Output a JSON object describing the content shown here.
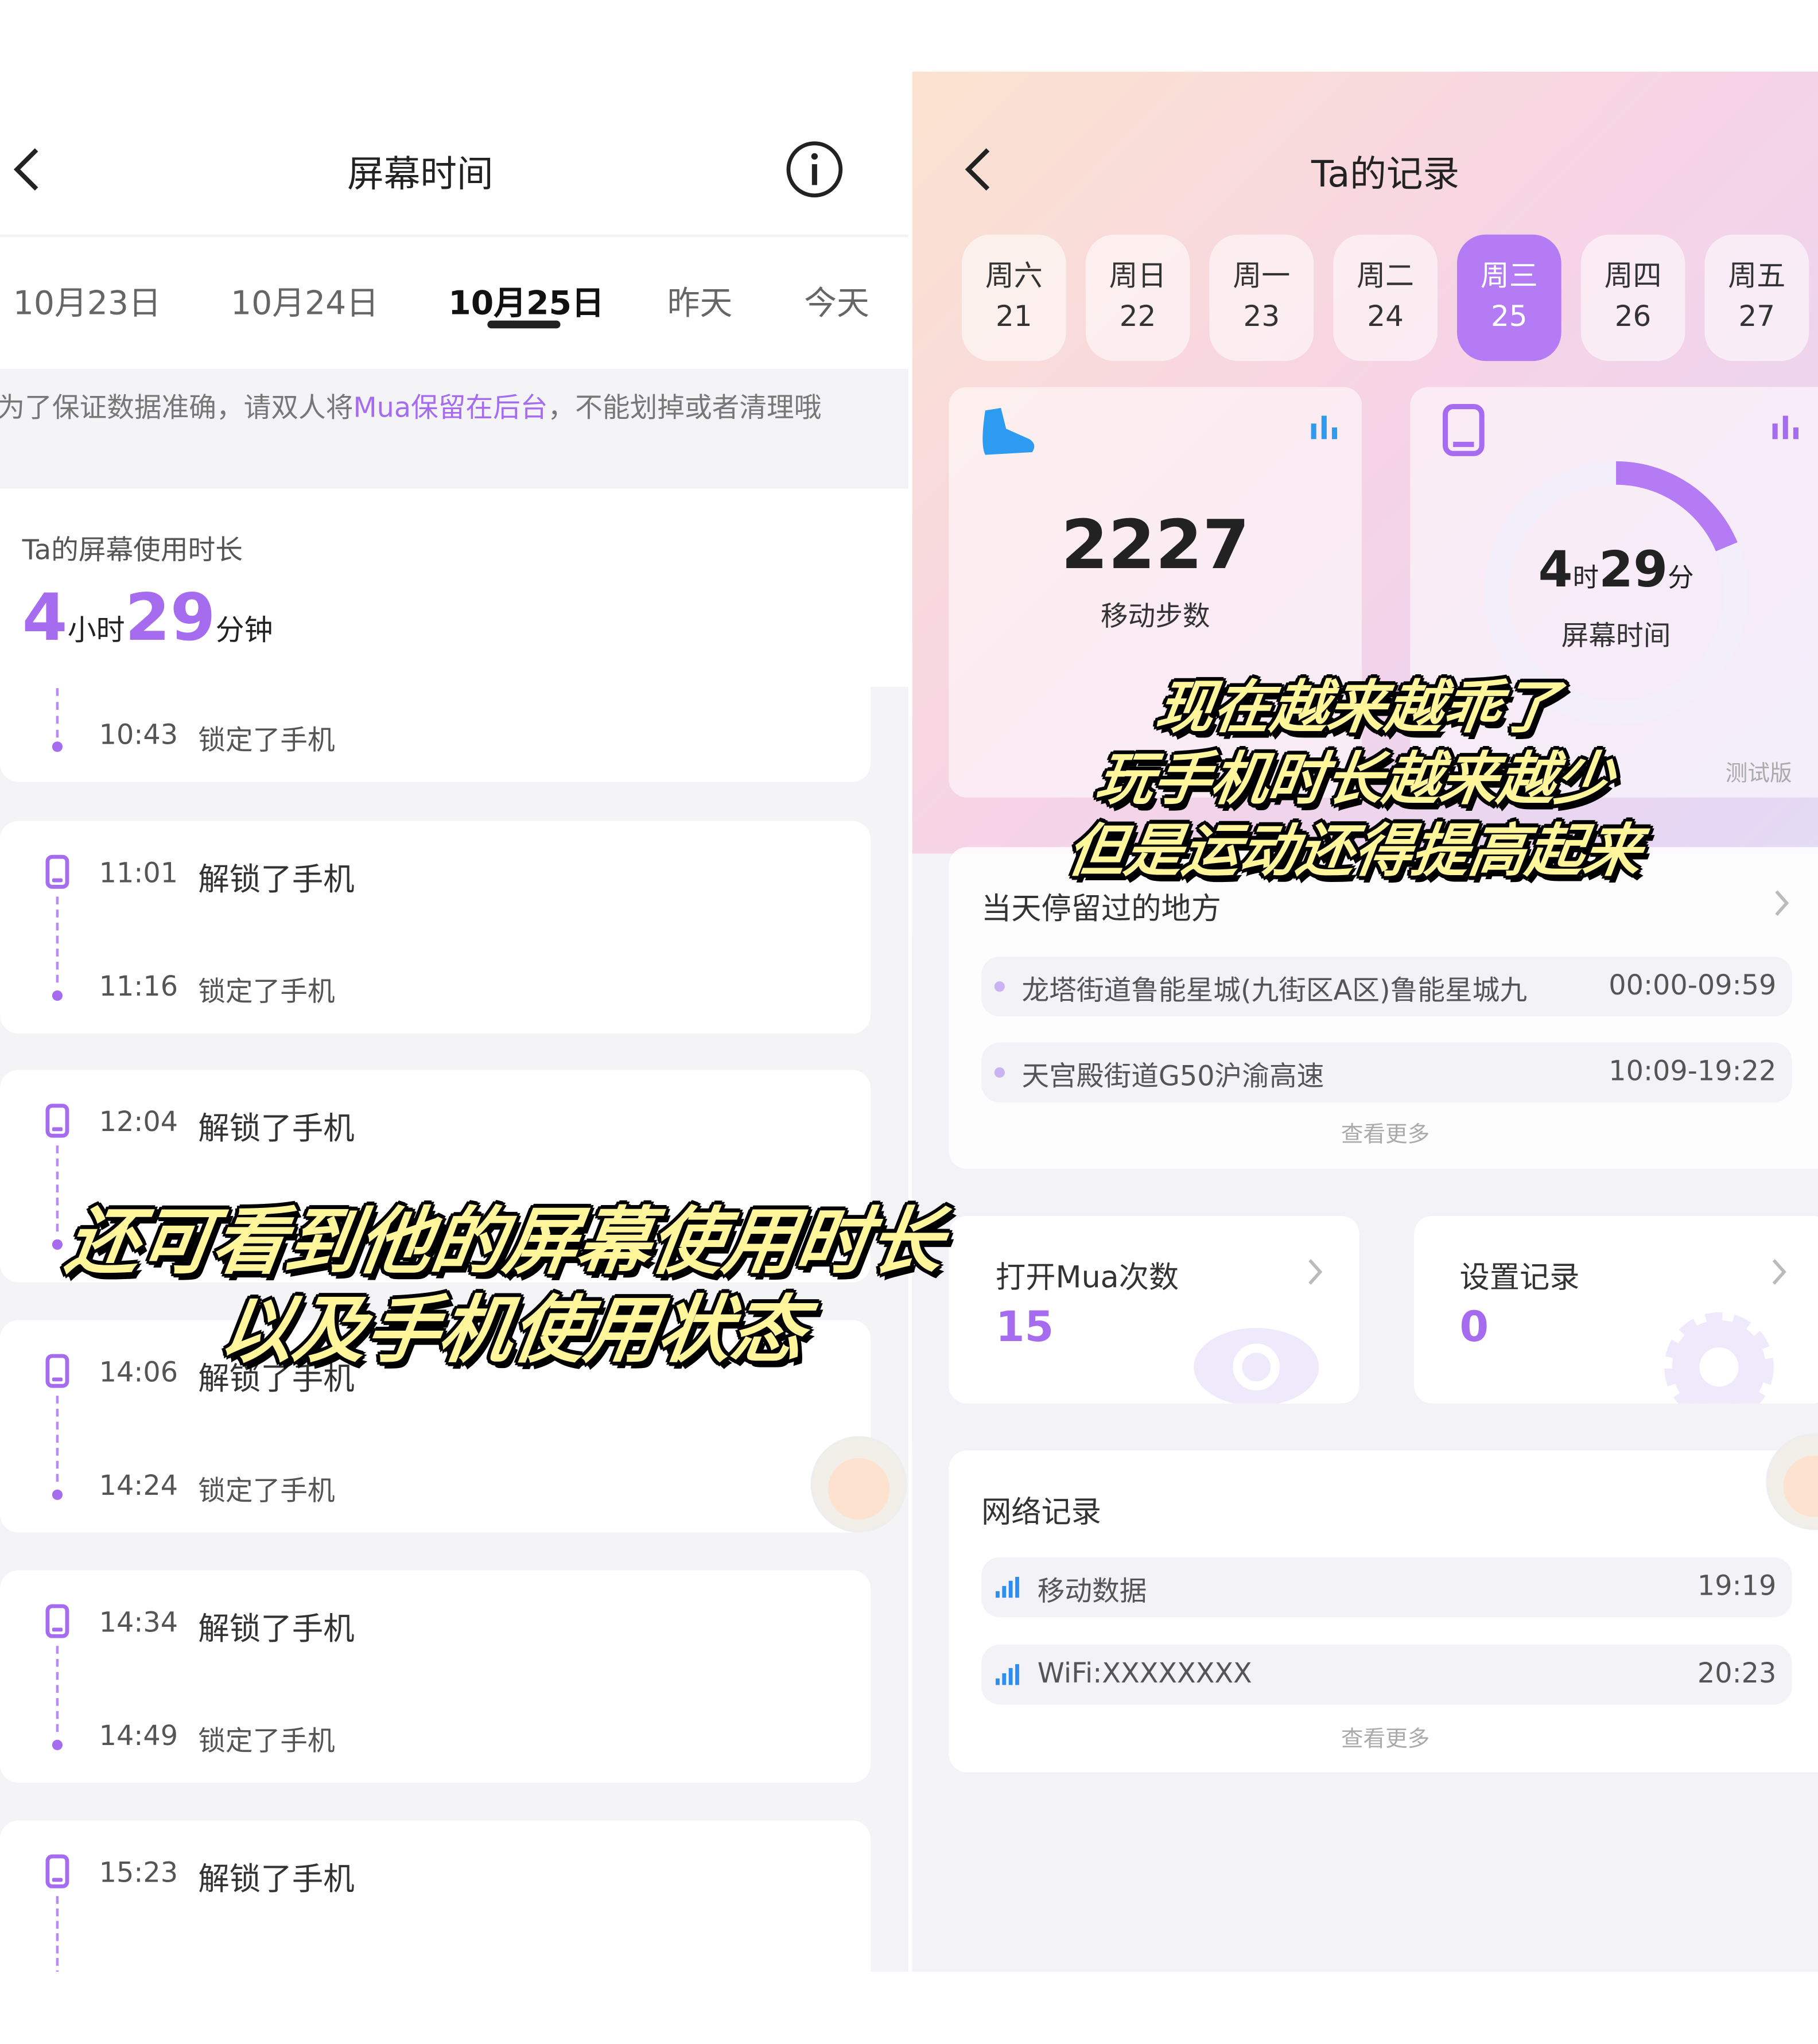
{
  "left": {
    "title": "屏幕时间",
    "date_tabs": [
      {
        "label": "10月23日"
      },
      {
        "label": "10月24日"
      },
      {
        "label": "10月25日",
        "active": true
      },
      {
        "label": "昨天"
      },
      {
        "label": "今天"
      }
    ],
    "notice": {
      "before": "为了保证数据准确，请双人将",
      "highlight": "Mua保留在后台",
      "after": "，不能划掉或者清理哦"
    },
    "usage_label": "Ta的屏幕使用时长",
    "usage": {
      "hours": "4",
      "hours_unit": "小时",
      "minutes": "29",
      "minutes_unit": "分钟"
    },
    "first_lock": {
      "time": "10:43",
      "event": "锁定了手机"
    },
    "entries": [
      {
        "unlock_time": "11:01",
        "unlock": "解锁了手机",
        "lock_time": "11:16",
        "lock": "锁定了手机"
      },
      {
        "unlock_time": "12:04",
        "unlock": "解锁了手机"
      },
      {
        "unlock_time": "14:06",
        "unlock": "解锁了手机",
        "lock_time": "14:24",
        "lock": "锁定了手机"
      },
      {
        "unlock_time": "14:34",
        "unlock": "解锁了手机",
        "lock_time": "14:49",
        "lock": "锁定了手机"
      },
      {
        "unlock_time": "15:23",
        "unlock": "解锁了手机"
      }
    ],
    "caption": [
      "还可看到他的屏幕使用时长",
      "以及手机使用状态"
    ]
  },
  "right": {
    "title": "Ta的记录",
    "days": [
      {
        "w": "周六",
        "d": "21"
      },
      {
        "w": "周日",
        "d": "22"
      },
      {
        "w": "周一",
        "d": "23"
      },
      {
        "w": "周二",
        "d": "24"
      },
      {
        "w": "周三",
        "d": "25",
        "active": true
      },
      {
        "w": "周四",
        "d": "26"
      },
      {
        "w": "周五",
        "d": "27"
      }
    ],
    "steps": {
      "value": "2227",
      "label": "移动步数"
    },
    "screen": {
      "h": "4",
      "h_unit": "时",
      "m": "29",
      "m_unit": "分",
      "label": "屏幕时间",
      "progress_fraction": 0.187
    },
    "beta": "测试版",
    "places": {
      "title": "当天停留过的地方",
      "items": [
        {
          "name": "龙塔街道鲁能星城(九街区A区)鲁能星城九",
          "time": "00:00-09:59"
        },
        {
          "name": "天宫殿街道G50沪渝高速",
          "time": "10:09-19:22"
        }
      ],
      "more": "查看更多"
    },
    "mua": {
      "title": "打开Mua次数",
      "value": "15"
    },
    "settings": {
      "title": "设置记录",
      "value": "0"
    },
    "network": {
      "title": "网络记录",
      "items": [
        {
          "name": "移动数据",
          "time": "19:19"
        },
        {
          "name": "WiFi:XXXXXXXX",
          "time": "20:23"
        }
      ],
      "more": "查看更多"
    },
    "caption": [
      "现在越来越乖了",
      "玩手机时长越来越少",
      "但是运动还得提高起来"
    ]
  },
  "colors": {
    "accent": "#a66cf0",
    "signal": "#2d8df0",
    "caption": "#fff59a"
  }
}
